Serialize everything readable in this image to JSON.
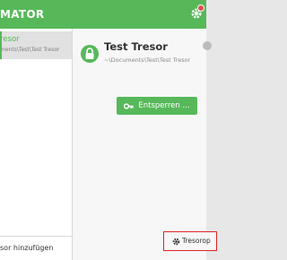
{
  "header": {
    "title": "MATOR"
  },
  "sidebar": {
    "vault": {
      "name": "resor",
      "path": "ments\\Test\\Test Tresor"
    },
    "add_vault_label": "sor hinzufügen"
  },
  "detail": {
    "title": "Test Tresor",
    "path": "~\\Documents\\Test\\Test Tresor",
    "unlock_label": "Entsperren ...",
    "options_label": "Tresorop"
  },
  "colors": {
    "accent": "#57b85a",
    "highlight_border": "#e02424"
  }
}
